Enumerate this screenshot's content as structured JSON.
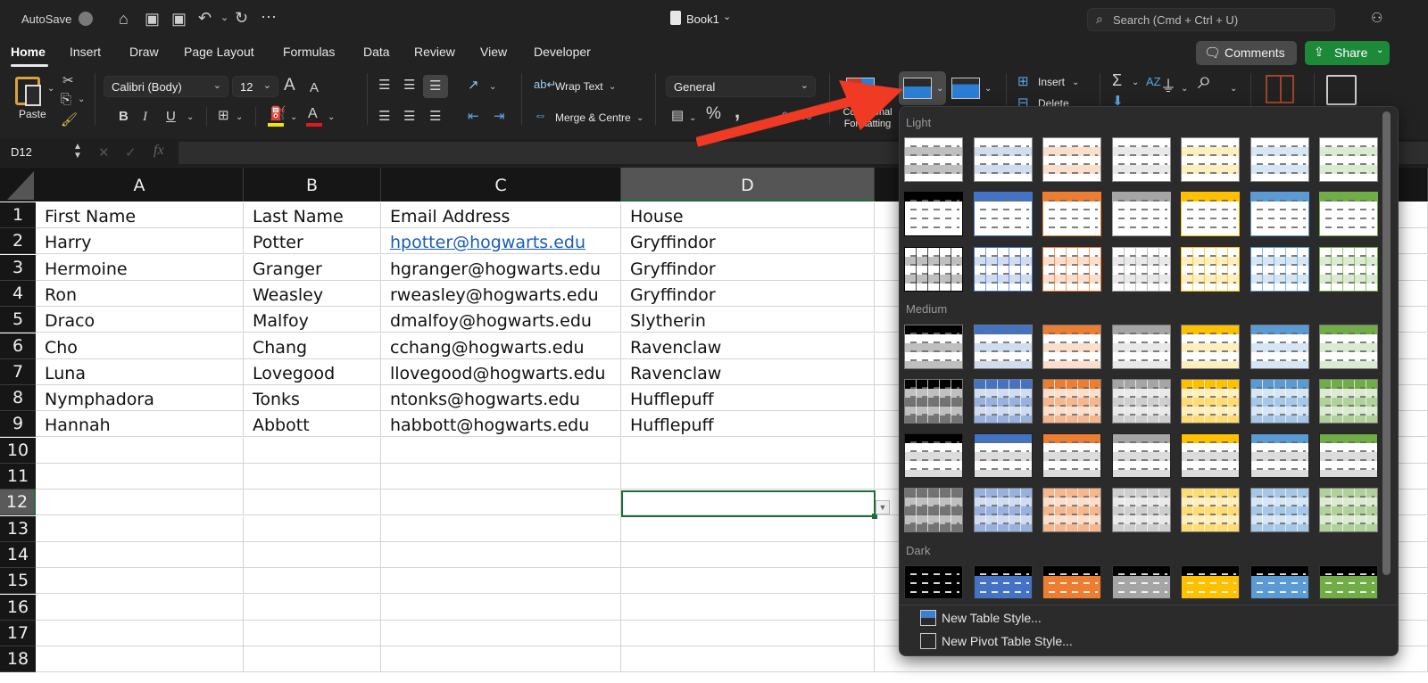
{
  "titlebar": {
    "autosave_label": "AutoSave",
    "quick_access": [
      "home-icon",
      "save-icon",
      "save-as-icon",
      "undo-icon",
      "redo-icon",
      "more-icon"
    ],
    "document_title": "Book1",
    "search_placeholder": "Search (Cmd + Ctrl + U)"
  },
  "tabs": [
    {
      "label": "Home",
      "active": true
    },
    {
      "label": "Insert"
    },
    {
      "label": "Draw"
    },
    {
      "label": "Page Layout"
    },
    {
      "label": "Formulas"
    },
    {
      "label": "Data"
    },
    {
      "label": "Review"
    },
    {
      "label": "View"
    },
    {
      "label": "Developer"
    }
  ],
  "header_buttons": {
    "comments": "Comments",
    "share": "Share"
  },
  "ribbon": {
    "paste_label": "Paste",
    "font_name": "Calibri (Body)",
    "font_size": "12",
    "bold": "B",
    "italic": "I",
    "underline": "U",
    "wrap_text": "Wrap Text",
    "merge_centre": "Merge & Centre",
    "number_format": "General",
    "percent": "%",
    "comma": ",",
    "conditional_formatting": "Conditional Formatting",
    "insert": "Insert",
    "delete": "Delete",
    "colors": {
      "highlight": "#f2e600",
      "font_color": "#e0191f",
      "accent_green": "#1d8a3a"
    }
  },
  "formula_bar": {
    "name_box": "D12",
    "cancel": "✕",
    "enter": "✓",
    "fx": "fx",
    "value": ""
  },
  "sheet": {
    "columns": [
      "A",
      "B",
      "C",
      "D"
    ],
    "selected_column": "D",
    "row_numbers": [
      "1",
      "2",
      "3",
      "4",
      "5",
      "6",
      "7",
      "8",
      "9",
      "10",
      "11",
      "12",
      "13",
      "14",
      "15",
      "16",
      "17",
      "18"
    ],
    "selected_row": "12",
    "rows": [
      [
        "First Name",
        "Last Name",
        " Email Address",
        "House"
      ],
      [
        "Harry",
        "Potter",
        "hpotter@hogwarts.edu",
        "Gryffindor"
      ],
      [
        "Hermoine",
        "Granger",
        "hgranger@hogwarts.edu",
        "Gryffindor"
      ],
      [
        "Ron",
        "Weasley",
        "rweasley@hogwarts.edu",
        "Gryffindor"
      ],
      [
        "Draco",
        "Malfoy",
        "dmalfoy@hogwarts.edu",
        "Slytherin"
      ],
      [
        "Cho",
        "Chang",
        "cchang@hogwarts.edu",
        "Ravenclaw"
      ],
      [
        "Luna",
        "Lovegood",
        "llovegood@hogwarts.edu",
        "Ravenclaw"
      ],
      [
        "Nymphadora",
        "Tonks",
        "ntonks@hogwarts.edu",
        "Hufflepuff"
      ],
      [
        "Hannah",
        "Abbott",
        "habbott@hogwarts.edu",
        "Hufflepuff"
      ]
    ],
    "hyperlink_cell": "C2",
    "active_cell": "D12"
  },
  "table_styles_gallery": {
    "sections": [
      "Light",
      "Medium",
      "Dark"
    ],
    "palette": [
      "#000000",
      "#4472c4",
      "#ed7d31",
      "#a5a5a5",
      "#ffc000",
      "#5b9bd5",
      "#70ad47"
    ],
    "footer": [
      "New Table Style...",
      "New Pivot Table Style..."
    ]
  },
  "annotation": {
    "arrow_color": "#f03a23",
    "points_to": "Format as Table"
  }
}
